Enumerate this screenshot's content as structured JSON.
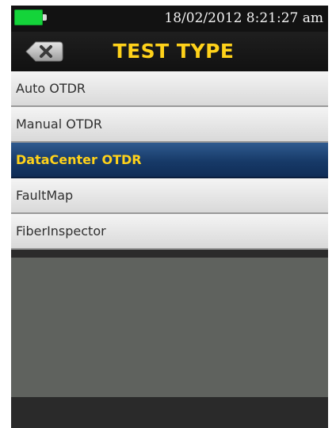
{
  "status_bar": {
    "datetime": "18/02/2012 8:21:27 am",
    "battery_icon": "battery-full-icon",
    "battery_color": "#14d43a"
  },
  "header": {
    "title": "TEST TYPE",
    "back_icon": "close-x-icon",
    "title_color": "#ffd21a"
  },
  "menu": {
    "selected_index": 2,
    "items": [
      {
        "label": "Auto OTDR"
      },
      {
        "label": "Manual OTDR"
      },
      {
        "label": "DataCenter OTDR"
      },
      {
        "label": "FaultMap"
      },
      {
        "label": "FiberInspector"
      }
    ]
  },
  "colors": {
    "selected_bg": "#173a68",
    "content_bg": "#5f625e"
  }
}
